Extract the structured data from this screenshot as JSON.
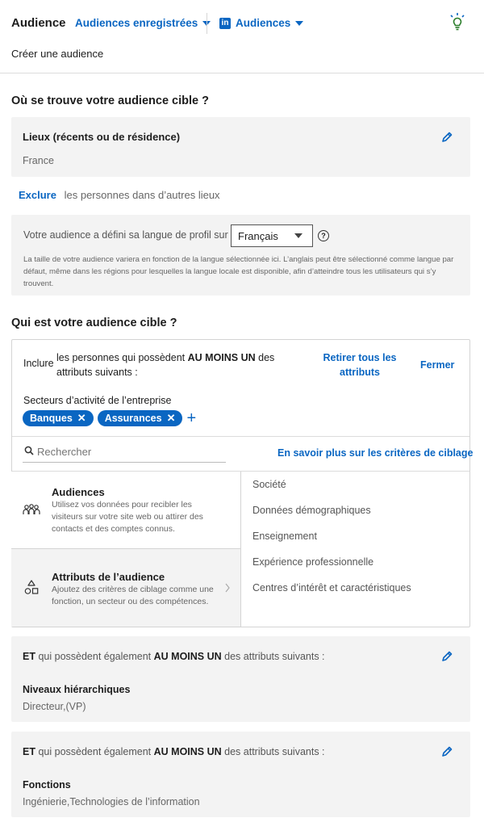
{
  "header": {
    "title": "Audience",
    "saved_audiences": "Audiences enregistrées",
    "linkedin_badge": "in",
    "audiences": "Audiences",
    "create": "Créer une audience"
  },
  "location": {
    "heading": "Où se trouve votre audience cible ?",
    "box_label": "Lieux (récents ou de résidence)",
    "box_value": "France",
    "exclude_link": "Exclure",
    "exclude_text": "les personnes dans d’autres lieux",
    "lang_label": "Votre audience a défini sa langue de profil sur",
    "lang_value": "Français",
    "help_glyph": "?",
    "lang_note": "La taille de votre audience variera en fonction de la langue sélectionnée ici. L’anglais peut être sélectionné comme langue par défaut, même dans les régions pour lesquelles la langue locale est disponible, afin d’atteindre tous les utilisateurs qui s’y trouvent."
  },
  "target": {
    "heading": "Qui est votre audience cible ?",
    "include_label": "Inclure",
    "include_text_1": "les personnes qui possèdent",
    "include_strong": "AU MOINS UN",
    "include_text_2": "des",
    "include_text_3": "attributs suivants :",
    "remove_all_1": "Retirer tous les",
    "remove_all_2": "attributs",
    "close": "Fermer",
    "sector_label": "Secteurs d’activité de l’entreprise",
    "pills": [
      "Banques",
      "Assurances"
    ],
    "pill_close": "✕",
    "add_glyph": "+",
    "search_placeholder": "Rechercher",
    "learn_more": "En savoir plus sur les critères de ciblage",
    "categories": [
      {
        "title": "Audiences",
        "desc": "Utilisez vos données pour recibler les visiteurs sur votre site web ou attirer des contacts et des comptes connus.",
        "icon": "people-group-icon"
      },
      {
        "title": "Attributs de l’audience",
        "desc": "Ajoutez des critères de ciblage comme une fonction, un secteur ou des compétences.",
        "icon": "shapes-icon"
      }
    ],
    "options": [
      "Société",
      "Données démographiques",
      "Enseignement",
      "Expérience professionnelle",
      "Centres d’intérêt et caractéristiques"
    ]
  },
  "and_blocks": [
    {
      "prefix": "ET",
      "text_1": "qui possèdent également",
      "strong": "AU MOINS UN",
      "text_2": "des attributs suivants :",
      "label": "Niveaux hiérarchiques",
      "value": "Directeur,(VP)"
    },
    {
      "prefix": "ET",
      "text_1": "qui possèdent également",
      "strong": "AU MOINS UN",
      "text_2": "des attributs suivants :",
      "label": "Fonctions",
      "value": "Ingénierie,Technologies de l’information"
    }
  ],
  "colors": {
    "accent": "#0a66c2",
    "panel_bg": "#f3f3f3"
  }
}
